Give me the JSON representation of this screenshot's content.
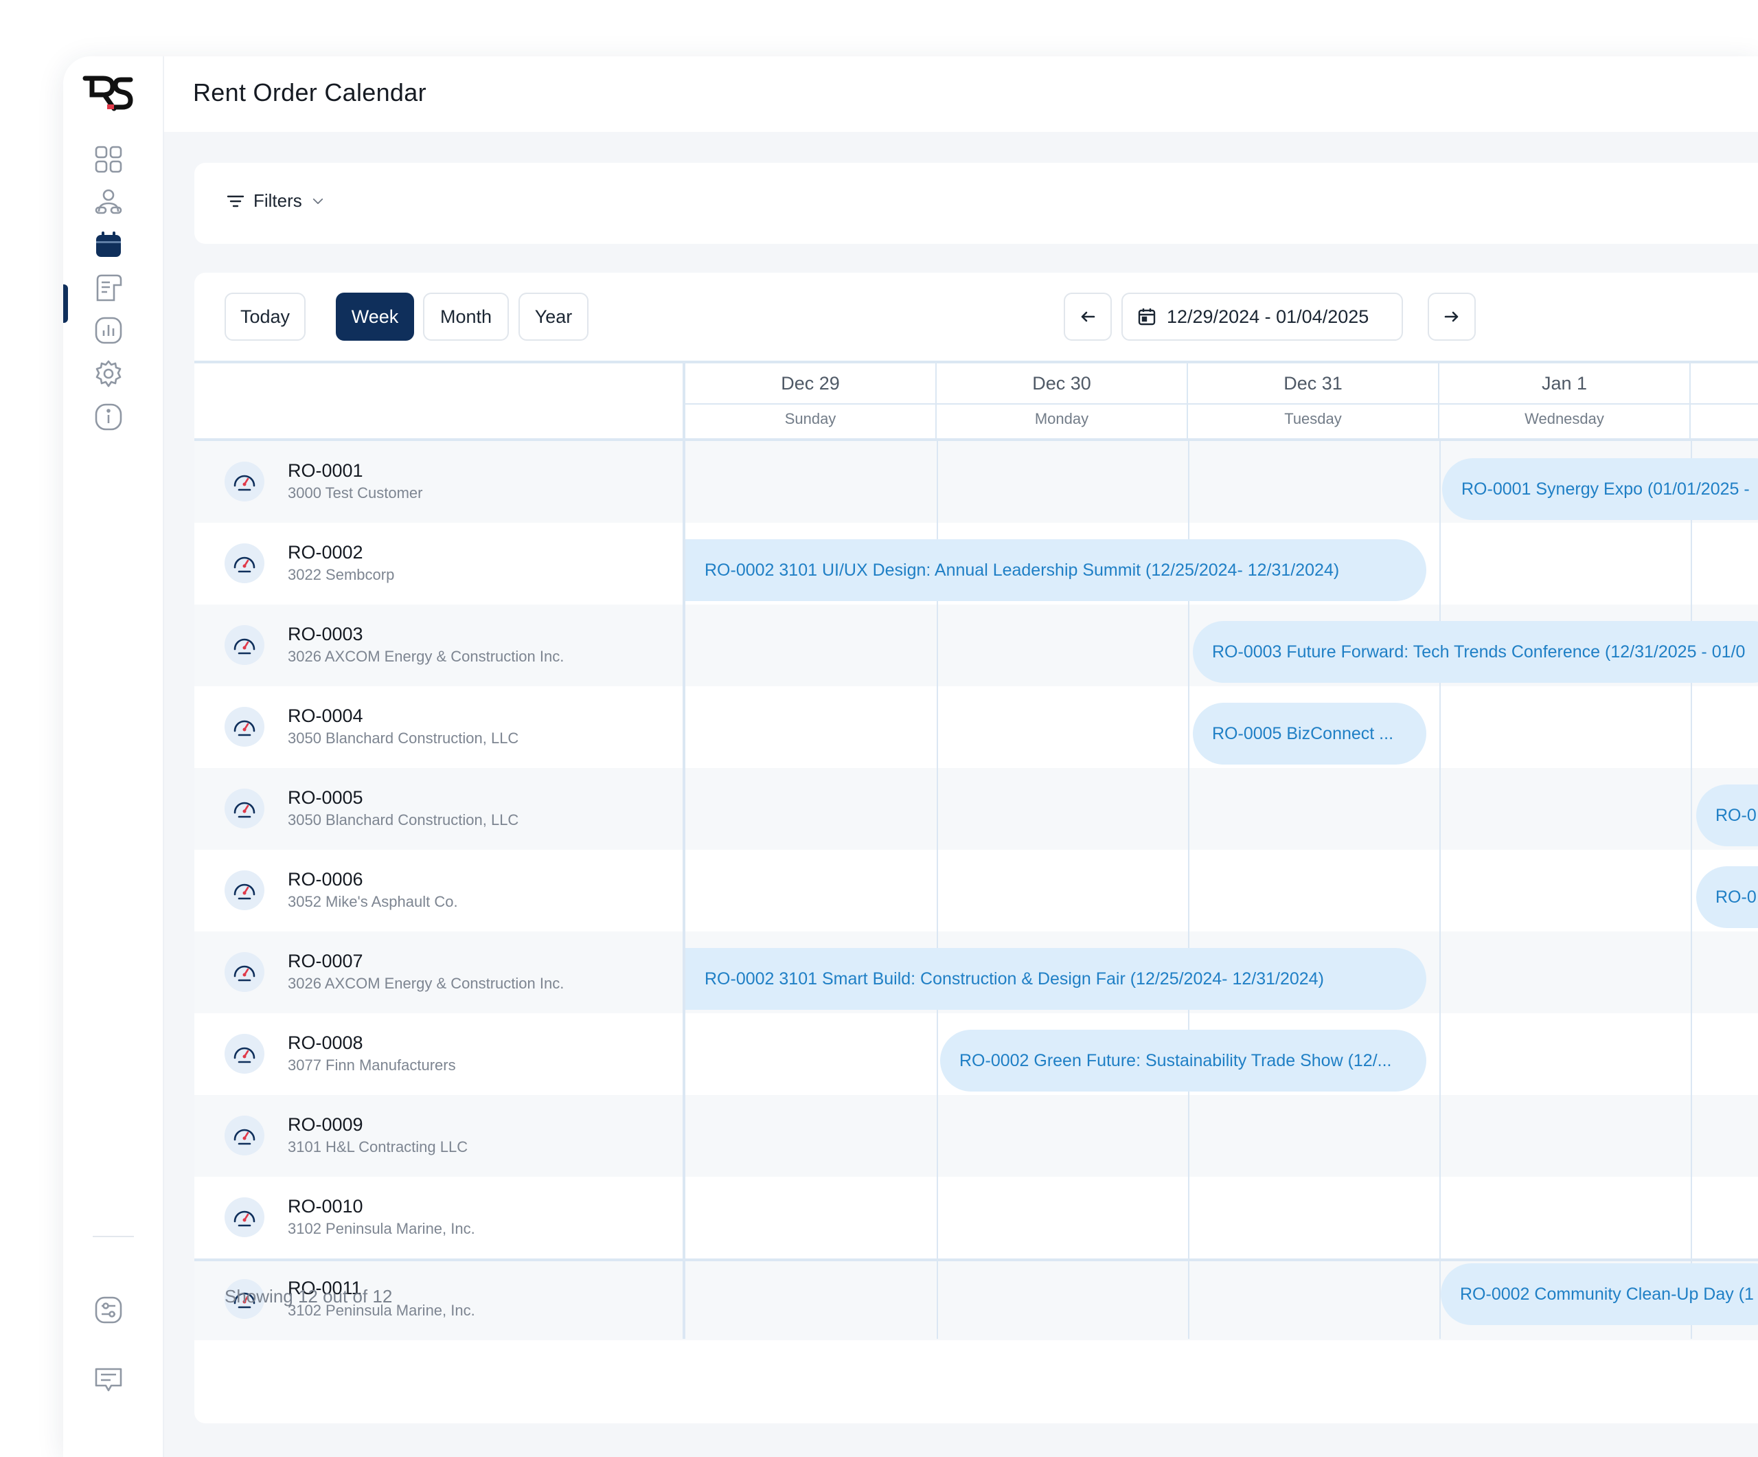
{
  "app": {
    "title": "Rent Order Calendar"
  },
  "sidebar": {
    "items": [
      {
        "icon": "dashboard-icon"
      },
      {
        "icon": "customers-icon"
      },
      {
        "icon": "calendar-icon",
        "active": true
      },
      {
        "icon": "orders-icon"
      },
      {
        "icon": "reports-icon"
      },
      {
        "icon": "settings-icon"
      },
      {
        "icon": "info-icon"
      }
    ],
    "bottom": [
      {
        "icon": "preferences-icon"
      },
      {
        "icon": "feedback-icon"
      }
    ]
  },
  "filters": {
    "label": "Filters"
  },
  "toolbar": {
    "today_label": "Today",
    "views": [
      "Week",
      "Month",
      "Year"
    ],
    "active_view": "Week",
    "date_range": "12/29/2024 - 01/04/2025"
  },
  "calendar": {
    "days": [
      {
        "date": "Dec 29",
        "weekday": "Sunday"
      },
      {
        "date": "Dec 30",
        "weekday": "Monday"
      },
      {
        "date": "Dec 31",
        "weekday": "Tuesday"
      },
      {
        "date": "Jan 1",
        "weekday": "Wednesday"
      }
    ],
    "rows": [
      {
        "id": "RO-0001",
        "customer": "3000 Test Customer"
      },
      {
        "id": "RO-0002",
        "customer": "3022 Sembcorp"
      },
      {
        "id": "RO-0003",
        "customer": "3026 AXCOM Energy & Construction Inc."
      },
      {
        "id": "RO-0004",
        "customer": "3050 Blanchard Construction, LLC"
      },
      {
        "id": "RO-0005",
        "customer": "3050 Blanchard Construction, LLC"
      },
      {
        "id": "RO-0006",
        "customer": "3052 Mike's Asphault Co."
      },
      {
        "id": "RO-0007",
        "customer": "3026 AXCOM Energy & Construction Inc."
      },
      {
        "id": "RO-0008",
        "customer": "3077 Finn Manufacturers"
      },
      {
        "id": "RO-0009",
        "customer": "3101 H&L Contracting LLC"
      },
      {
        "id": "RO-0010",
        "customer": "3102 Peninsula Marine, Inc."
      },
      {
        "id": "RO-0011",
        "customer": "3102 Peninsula Marine, Inc."
      }
    ],
    "events": [
      {
        "label": "RO-0001 Synergy Expo (01/01/2025 -"
      },
      {
        "label": "RO-0002 3101 UI/UX Design: Annual Leadership Summit (12/25/2024- 12/31/2024)"
      },
      {
        "label": "RO-0003 Future Forward: Tech Trends Conference (12/31/2025 - 01/0"
      },
      {
        "label": "RO-0005 BizConnect ..."
      },
      {
        "label": "RO-0"
      },
      {
        "label": "RO-0"
      },
      {
        "label": "RO-0002 3101 Smart Build: Construction & Design Fair (12/25/2024- 12/31/2024)"
      },
      {
        "label": "RO-0002 Green Future: Sustainability Trade Show (12/..."
      },
      {
        "label": "RO-0002 Community Clean-Up Day (1"
      }
    ]
  },
  "footer": {
    "showing": "Showing 12 out of 12"
  },
  "colors": {
    "brand": "#0f2f5b",
    "event_bg": "#dcedfb",
    "event_text": "#1f7fc5",
    "accent_red": "#e03a4a"
  }
}
